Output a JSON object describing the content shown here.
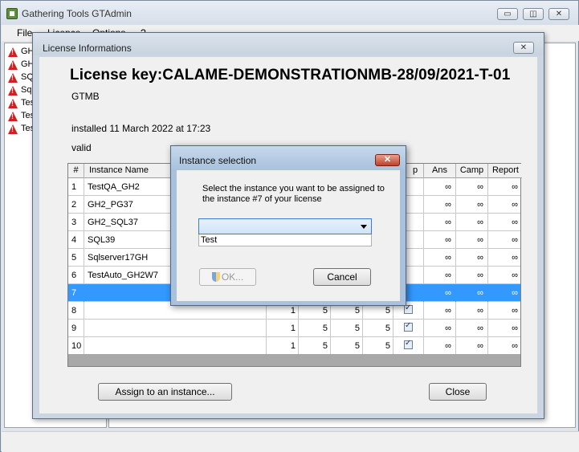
{
  "app": {
    "title": "Gathering Tools GTAdmin",
    "window_controls": {
      "minimize": "▭",
      "restore": "◫",
      "close": "✕"
    },
    "menu": [
      "File",
      "Licence",
      "Options",
      "?"
    ],
    "tree_items": [
      "GH",
      "GH",
      "SQ",
      "Sql",
      "Tes",
      "Tes",
      "Tes"
    ]
  },
  "license_dialog": {
    "title": "License Informations",
    "close": "✕",
    "key_label": "License key:CALAME-DEMONSTRATIONMB-28/09/2021-T-01",
    "code": "GTMB",
    "installed": "installed 11 March 2022 at 17:23",
    "validity": "valid",
    "columns": [
      "#",
      "Instance Name",
      "",
      "",
      "",
      "",
      "p",
      "Ans",
      "Camp",
      "Report"
    ],
    "rows": [
      {
        "num": "1",
        "name": "TestQA_GH2",
        "c1": "",
        "c2": "",
        "c3": "",
        "c4": "",
        "chk": false,
        "ans": "∞",
        "camp": "∞",
        "report": "∞"
      },
      {
        "num": "2",
        "name": "GH2_PG37",
        "c1": "",
        "c2": "",
        "c3": "",
        "c4": "",
        "chk": false,
        "ans": "∞",
        "camp": "∞",
        "report": "∞"
      },
      {
        "num": "3",
        "name": "GH2_SQL37",
        "c1": "",
        "c2": "",
        "c3": "",
        "c4": "",
        "chk": false,
        "ans": "∞",
        "camp": "∞",
        "report": "∞"
      },
      {
        "num": "4",
        "name": "SQL39",
        "c1": "",
        "c2": "",
        "c3": "",
        "c4": "",
        "chk": false,
        "ans": "∞",
        "camp": "∞",
        "report": "∞"
      },
      {
        "num": "5",
        "name": "Sqlserver17GH",
        "c1": "",
        "c2": "",
        "c3": "",
        "c4": "",
        "chk": false,
        "ans": "∞",
        "camp": "∞",
        "report": "∞"
      },
      {
        "num": "6",
        "name": "TestAuto_GH2W7",
        "c1": "",
        "c2": "",
        "c3": "",
        "c4": "",
        "chk": false,
        "ans": "∞",
        "camp": "∞",
        "report": "∞"
      },
      {
        "num": "7",
        "name": "",
        "c1": "",
        "c2": "",
        "c3": "",
        "c4": "",
        "chk": false,
        "ans": "∞",
        "camp": "∞",
        "report": "∞"
      },
      {
        "num": "8",
        "name": "",
        "c1": "1",
        "c2": "5",
        "c3": "5",
        "c4": "5",
        "chk": true,
        "ans": "∞",
        "camp": "∞",
        "report": "∞"
      },
      {
        "num": "9",
        "name": "",
        "c1": "1",
        "c2": "5",
        "c3": "5",
        "c4": "5",
        "chk": true,
        "ans": "∞",
        "camp": "∞",
        "report": "∞"
      },
      {
        "num": "10",
        "name": "",
        "c1": "1",
        "c2": "5",
        "c3": "5",
        "c4": "5",
        "chk": true,
        "ans": "∞",
        "camp": "∞",
        "report": "∞"
      }
    ],
    "selected_row": 7,
    "assign_button": "Assign to an instance...",
    "close_button": "Close"
  },
  "instance_dialog": {
    "title": "Instance selection",
    "close": "✕",
    "message": "Select the instance you want to be assigned to the instance #7 of your license",
    "combo_value": "",
    "options": [
      "Test"
    ],
    "ok_button": "OK...",
    "cancel_button": "Cancel"
  }
}
